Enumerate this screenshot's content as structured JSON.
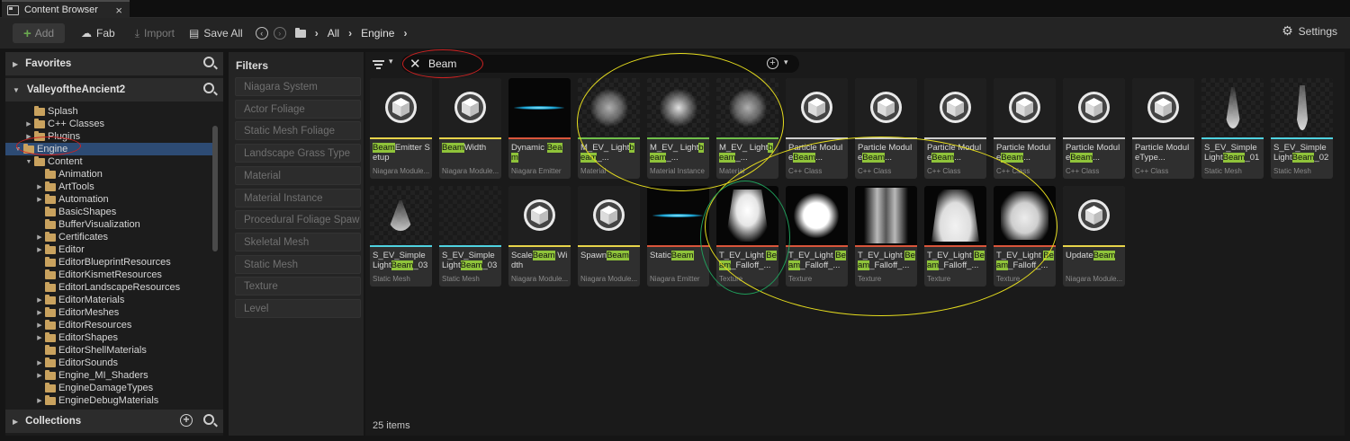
{
  "tab": {
    "title": "Content Browser",
    "close": "×"
  },
  "toolbar": {
    "add_label": "Add",
    "fab_label": "Fab",
    "import_label": "Import",
    "saveall_label": "Save All",
    "settings_label": "Settings",
    "breadcrumb": [
      "All",
      "Engine"
    ]
  },
  "left": {
    "favorites_label": "Favorites",
    "project_label": "ValleyoftheAncient2",
    "collections_label": "Collections",
    "tree": [
      {
        "label": "Splash",
        "indent": 1,
        "arrow": ""
      },
      {
        "label": "C++ Classes",
        "indent": 1,
        "arrow": "▶"
      },
      {
        "label": "Plugins",
        "indent": 1,
        "arrow": "▶"
      },
      {
        "label": "Engine",
        "indent": 0,
        "arrow": "▼",
        "selected": true
      },
      {
        "label": "Content",
        "indent": 1,
        "arrow": "▼"
      },
      {
        "label": "Animation",
        "indent": 2,
        "arrow": ""
      },
      {
        "label": "ArtTools",
        "indent": 2,
        "arrow": "▶"
      },
      {
        "label": "Automation",
        "indent": 2,
        "arrow": "▶"
      },
      {
        "label": "BasicShapes",
        "indent": 2,
        "arrow": ""
      },
      {
        "label": "BufferVisualization",
        "indent": 2,
        "arrow": ""
      },
      {
        "label": "Certificates",
        "indent": 2,
        "arrow": "▶"
      },
      {
        "label": "Editor",
        "indent": 2,
        "arrow": "▶"
      },
      {
        "label": "EditorBlueprintResources",
        "indent": 2,
        "arrow": ""
      },
      {
        "label": "EditorKismetResources",
        "indent": 2,
        "arrow": ""
      },
      {
        "label": "EditorLandscapeResources",
        "indent": 2,
        "arrow": ""
      },
      {
        "label": "EditorMaterials",
        "indent": 2,
        "arrow": "▶"
      },
      {
        "label": "EditorMeshes",
        "indent": 2,
        "arrow": "▶"
      },
      {
        "label": "EditorResources",
        "indent": 2,
        "arrow": "▶"
      },
      {
        "label": "EditorShapes",
        "indent": 2,
        "arrow": "▶"
      },
      {
        "label": "EditorShellMaterials",
        "indent": 2,
        "arrow": ""
      },
      {
        "label": "EditorSounds",
        "indent": 2,
        "arrow": "▶"
      },
      {
        "label": "Engine_MI_Shaders",
        "indent": 2,
        "arrow": "▶"
      },
      {
        "label": "EngineDamageTypes",
        "indent": 2,
        "arrow": ""
      },
      {
        "label": "EngineDebugMaterials",
        "indent": 2,
        "arrow": "▶"
      }
    ]
  },
  "filters": {
    "header": "Filters",
    "items": [
      "Niagara System",
      "Actor Foliage",
      "Static Mesh Foliage",
      "Landscape Grass Type",
      "Material",
      "Material Instance",
      "Procedural Foliage Spaw",
      "Skeletal Mesh",
      "Static Mesh",
      "Texture",
      "Level"
    ]
  },
  "search": {
    "value": "Beam"
  },
  "assets": [
    {
      "pre": "",
      "hl": "Beam",
      "post": "Emitter Setup",
      "type": "Niagara Module...",
      "thumb": "cube",
      "stripe": "#e8d44a"
    },
    {
      "pre": "",
      "hl": "Beam",
      "post": "Width",
      "type": "Niagara Module...",
      "thumb": "cube",
      "stripe": "#e8d44a"
    },
    {
      "pre": "Dynamic ",
      "hl": "Beam",
      "post": "",
      "type": "Niagara Emitter",
      "thumb": "beam",
      "stripe": "#d9553b"
    },
    {
      "pre": "M_EV_ Light",
      "hl": "beam",
      "post": "_...",
      "type": "Material",
      "thumb": "blob",
      "stripe": "#6fbf4a"
    },
    {
      "pre": "M_EV_ Light",
      "hl": "beam",
      "post": "_...",
      "type": "Material Instance",
      "thumb": "blob2",
      "stripe": "#6fbf4a"
    },
    {
      "pre": "M_EV_ Light",
      "hl": "beam",
      "post": "_...",
      "type": "Material",
      "thumb": "blob",
      "stripe": "#6fbf4a"
    },
    {
      "pre": "Particle Module",
      "hl": "Beam",
      "post": "...",
      "type": "C++ Class",
      "thumb": "cube",
      "stripe": "#cfcfcf"
    },
    {
      "pre": "Particle Module",
      "hl": "Beam",
      "post": "...",
      "type": "C++ Class",
      "thumb": "cube",
      "stripe": "#cfcfcf"
    },
    {
      "pre": "Particle Module",
      "hl": "Beam",
      "post": "...",
      "type": "C++ Class",
      "thumb": "cube",
      "stripe": "#cfcfcf"
    },
    {
      "pre": "Particle Module",
      "hl": "Beam",
      "post": "...",
      "type": "C++ Class",
      "thumb": "cube",
      "stripe": "#cfcfcf"
    },
    {
      "pre": "Particle Module",
      "hl": "Beam",
      "post": "...",
      "type": "C++ Class",
      "thumb": "cube",
      "stripe": "#cfcfcf"
    },
    {
      "pre": "Particle ModuleType",
      "hl": "",
      "post": "...",
      "type": "C++ Class",
      "thumb": "cube",
      "stripe": "#cfcfcf"
    },
    {
      "pre": "S_EV_Simple Light",
      "hl": "Beam",
      "post": "_01",
      "type": "Static Mesh",
      "thumb": "cone",
      "stripe": "#4fd2e0"
    },
    {
      "pre": "S_EV_Simple Light",
      "hl": "Beam",
      "post": "_02",
      "type": "Static Mesh",
      "thumb": "cone2",
      "stripe": "#4fd2e0"
    },
    {
      "pre": "S_EV_Simple Light",
      "hl": "Beam",
      "post": "_03",
      "type": "Static Mesh",
      "thumb": "cone3",
      "stripe": "#4fd2e0"
    },
    {
      "pre": "S_EV_Simple Light",
      "hl": "Beam",
      "post": "_03",
      "type": "Static Mesh",
      "thumb": "empty",
      "stripe": "#4fd2e0"
    },
    {
      "pre": "Scale",
      "hl": "Beam",
      "post": " Width",
      "type": "Niagara Module...",
      "thumb": "cube",
      "stripe": "#e8d44a"
    },
    {
      "pre": "Spawn",
      "hl": "Beam",
      "post": "",
      "type": "Niagara Module...",
      "thumb": "cube",
      "stripe": "#e8d44a"
    },
    {
      "pre": "Static",
      "hl": "Beam",
      "post": "",
      "type": "Niagara Emitter",
      "thumb": "beam",
      "stripe": "#d9553b"
    },
    {
      "pre": "T_EV_Light ",
      "hl": "Beam",
      "post": "_Falloff_...",
      "type": "Texture",
      "thumb": "tex1",
      "stripe": "#d9553b"
    },
    {
      "pre": "T_EV_Light ",
      "hl": "Beam",
      "post": "_Falloff_...",
      "type": "Texture",
      "thumb": "tex2",
      "stripe": "#d9553b"
    },
    {
      "pre": "T_EV_Light ",
      "hl": "Beam",
      "post": "_Falloff_...",
      "type": "Texture",
      "thumb": "tex3",
      "stripe": "#d9553b"
    },
    {
      "pre": "T_EV_Light ",
      "hl": "Beam",
      "post": "_Falloff_...",
      "type": "Texture",
      "thumb": "tex4",
      "stripe": "#d9553b"
    },
    {
      "pre": "T_EV_Light ",
      "hl": "Beam",
      "post": "_Falloff_...",
      "type": "Texture",
      "thumb": "tex5",
      "stripe": "#d9553b"
    },
    {
      "pre": "Update",
      "hl": "Beam",
      "post": "",
      "type": "Niagara Module...",
      "thumb": "cube",
      "stripe": "#e8d44a"
    }
  ],
  "status": {
    "items_count": "25 items"
  },
  "colors": {
    "selection": "#2d4b74",
    "highlight": "#8fc33a",
    "annot_red": "#cc2222",
    "annot_yellow": "#e6dd1e",
    "annot_green": "#1f9c5a"
  }
}
